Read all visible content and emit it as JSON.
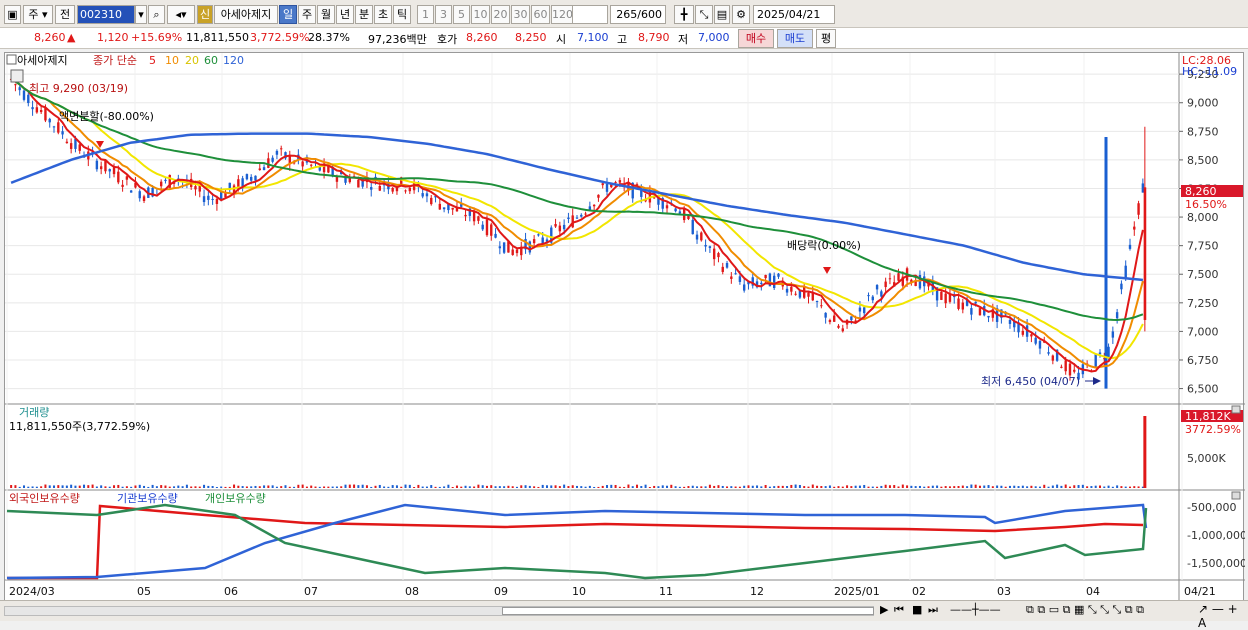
{
  "toolbar": {
    "period_label": "주",
    "period2_label": "전",
    "code": "002310",
    "new_badge": "신",
    "stock_name": "아세아제지",
    "tabs": [
      "일",
      "주",
      "월",
      "년",
      "분",
      "초",
      "틱"
    ],
    "intervals": [
      "1",
      "3",
      "5",
      "10",
      "20",
      "30",
      "60",
      "120"
    ],
    "count": "265/600",
    "date": "2025/04/21"
  },
  "info": {
    "price": "8,260",
    "change": "1,120",
    "change_pct": "+15.69%",
    "volume": "11,811,550",
    "volume_ratio": "3,772.59%",
    "turnover": "28.37%",
    "amount": "97,236백만",
    "quote_label": "호가",
    "ask": "8,260",
    "bid": "8,250",
    "open_label": "시",
    "open": "7,100",
    "high_label": "고",
    "high": "8,790",
    "low_label": "저",
    "low": "7,000",
    "buy_label": "매수",
    "sell_label": "매도",
    "eval_label": "평"
  },
  "chart": {
    "legend_name": "아세아제지",
    "legend_ma": "종가 단순",
    "ma_periods": [
      "5",
      "10",
      "20",
      "60",
      "120"
    ],
    "lc_label": "LC:28.06",
    "hc_label": "HC:-11.09",
    "high_note": "최고 9,290 (03/19)",
    "split_note": "액면분할(-80.00%)",
    "dividend_note": "배당락(0.00%)",
    "low_note": "최저 6,450 (04/07)",
    "price_badge": "8,260",
    "price_badge_pct": "16.50%",
    "volume_title": "거래량",
    "volume_value": "11,811,550주(3,772.59%)",
    "volume_badge": "11,812K",
    "volume_badge_pct": "3772.59%",
    "volume_tick": "5,000K",
    "holders_legend": [
      "외국인보유수량",
      "기관보유수량",
      "개인보유수량"
    ],
    "holders_ticks": [
      "-500,000",
      "-1,000,000",
      "-1,500,000"
    ],
    "y_ticks": [
      "9,250",
      "9,000",
      "8,750",
      "8,500",
      "8,250",
      "8,000",
      "7,750",
      "7,500",
      "7,250",
      "7,000",
      "6,750",
      "6,500"
    ],
    "x_labels": [
      "2024/03",
      "05",
      "06",
      "07",
      "08",
      "09",
      "10",
      "11",
      "12",
      "2025/01",
      "02",
      "03",
      "04",
      "04/21"
    ],
    "colors": {
      "ma5": "#e01818",
      "ma10": "#f08c00",
      "ma20": "#f2e600",
      "ma60": "#1e8f3a",
      "ma120": "#2f63d6",
      "up": "#e01818",
      "down": "#1a5fd1"
    }
  },
  "chart_data": {
    "type": "line",
    "title": "아세아제지",
    "ylim": [
      6400,
      9400
    ],
    "series": [
      {
        "name": "5",
        "values": [
          9200,
          8900,
          8600,
          8400,
          8200,
          8350,
          8150,
          8300,
          8550,
          8450,
          8350,
          8300,
          8280,
          8100,
          8000,
          7700,
          7800,
          8000,
          8300,
          8200,
          8100,
          7700,
          7400,
          7450,
          7300,
          7000,
          7350,
          7500,
          7300,
          7200,
          7100,
          6900,
          6600,
          6850,
          8260
        ]
      },
      {
        "name": "120",
        "values": [
          8300,
          8500,
          8650,
          8720,
          8730,
          8730,
          8700,
          8640,
          8550,
          8420,
          8300,
          8200,
          8100,
          8020,
          7950,
          7850,
          7750,
          7600,
          7500,
          7450
        ]
      }
    ]
  }
}
